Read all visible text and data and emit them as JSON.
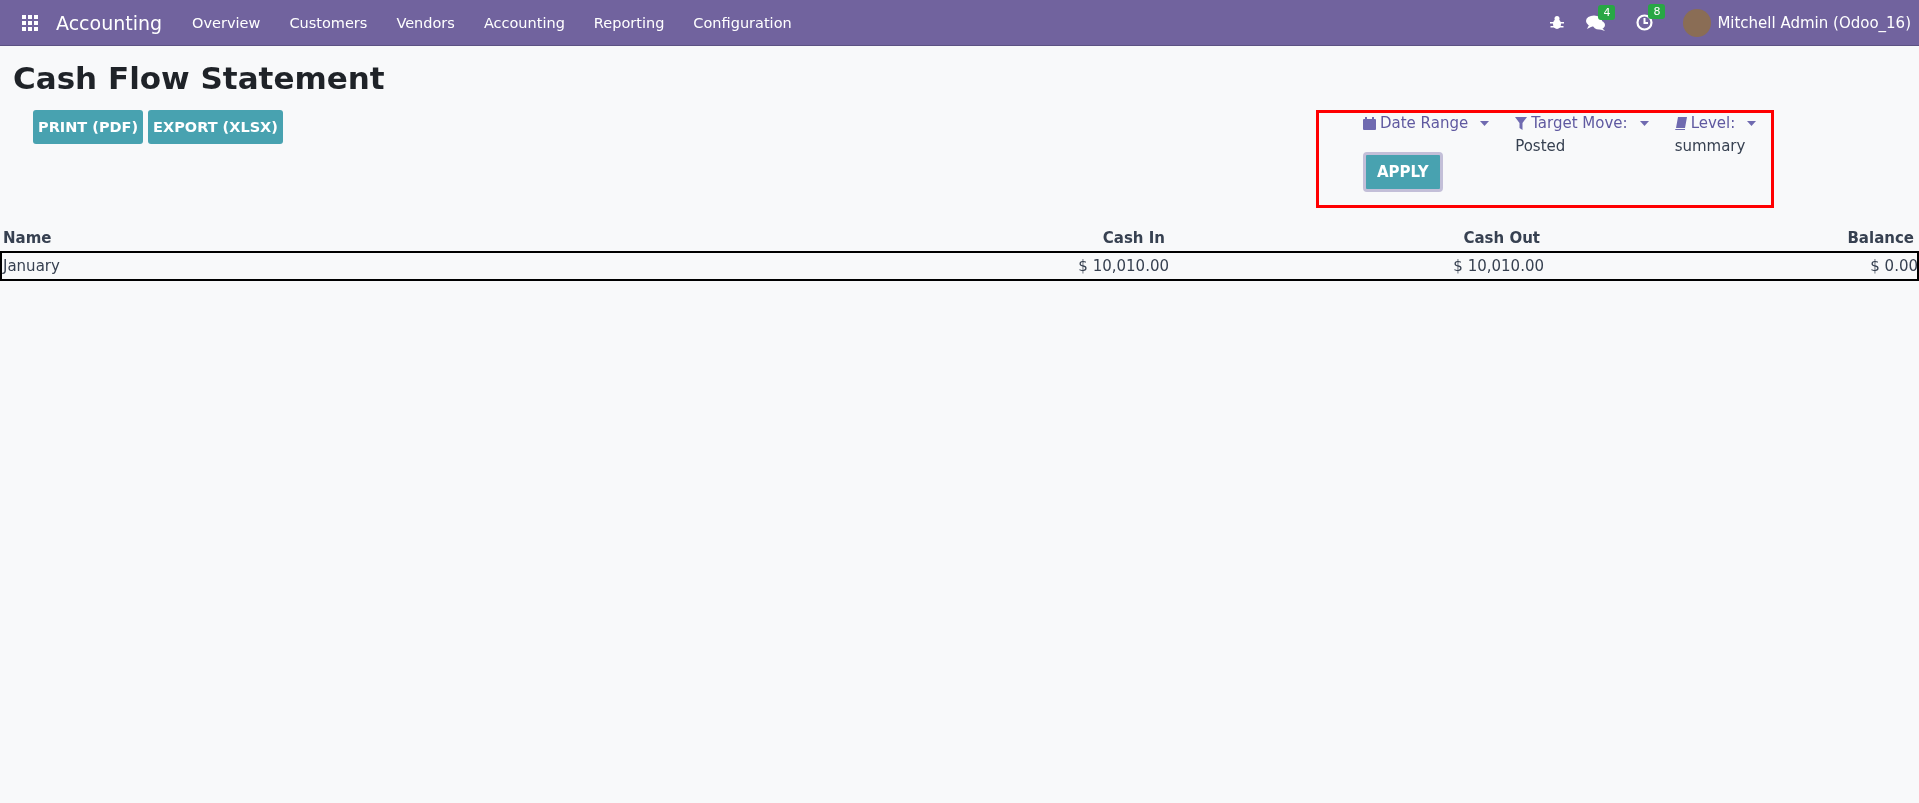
{
  "navbar": {
    "app_name": "Accounting",
    "menu": [
      {
        "label": "Overview"
      },
      {
        "label": "Customers"
      },
      {
        "label": "Vendors"
      },
      {
        "label": "Accounting"
      },
      {
        "label": "Reporting"
      },
      {
        "label": "Configuration"
      }
    ],
    "messages_count": "4",
    "activities_count": "8",
    "user": "Mitchell Admin (Odoo_16)"
  },
  "page": {
    "title": "Cash Flow Statement",
    "buttons": [
      "PRINT (PDF)",
      "EXPORT (XLSX)"
    ]
  },
  "filters": {
    "items": [
      {
        "kind": "calendar",
        "label": "Date Range"
      },
      {
        "kind": "filter",
        "label": "Target Move:",
        "value": "Posted"
      },
      {
        "kind": "book",
        "label": "Level:",
        "value": "summary"
      }
    ],
    "apply": "APPLY"
  },
  "table": {
    "columns": [
      "Name",
      "Cash In",
      "Cash Out",
      "Balance"
    ],
    "rows": [
      {
        "cells": [
          "January",
          "$ 10,010.00",
          "$ 10,010.00",
          "$ 0.00"
        ]
      }
    ]
  }
}
